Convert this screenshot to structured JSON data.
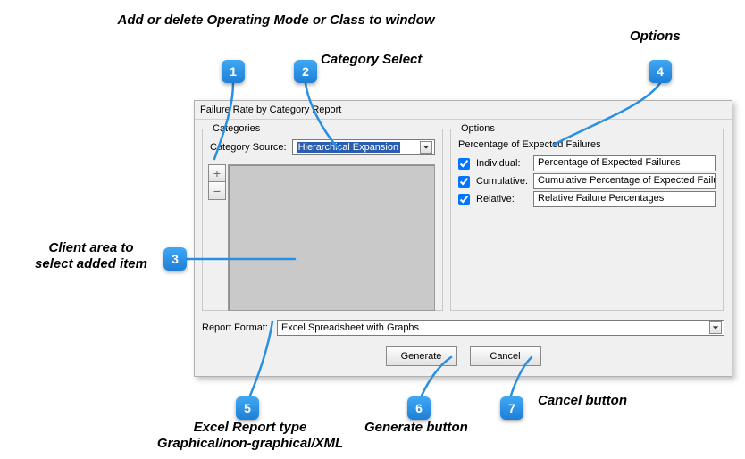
{
  "annotations": {
    "a1": "Add or delete Operating Mode or Class to window",
    "a2": "Category Select",
    "a3_l1": "Client area to",
    "a3_l2": "select added item",
    "a4": "Options",
    "a5_l1": "Excel Report type",
    "a5_l2": "Graphical/non-graphical/XML",
    "a6": "Generate button",
    "a7": "Cancel button"
  },
  "badges": {
    "b1": "1",
    "b2": "2",
    "b3": "3",
    "b4": "4",
    "b5": "5",
    "b6": "6",
    "b7": "7"
  },
  "dialog": {
    "title": "Failure Rate by Category Report",
    "categories": {
      "legend": "Categories",
      "source_label": "Category Source:",
      "source_value": "Hierarchical Expansion",
      "add_glyph": "+",
      "remove_glyph": "−"
    },
    "options": {
      "legend": "Options",
      "heading": "Percentage of Expected Failures",
      "rows": [
        {
          "label": "Individual:",
          "value": "Percentage of Expected Failures"
        },
        {
          "label": "Cumulative:",
          "value": "Cumulative Percentage of Expected Failures"
        },
        {
          "label": "Relative:",
          "value": "Relative Failure Percentages"
        }
      ]
    },
    "format": {
      "label": "Report Format:",
      "value": "Excel Spreadsheet with Graphs"
    },
    "buttons": {
      "generate": "Generate",
      "cancel": "Cancel"
    }
  }
}
